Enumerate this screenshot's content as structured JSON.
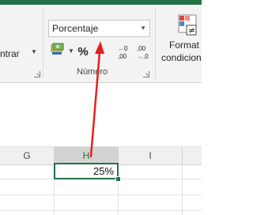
{
  "ribbon": {
    "alignment": {
      "center_label": "ntrar"
    },
    "number": {
      "format_value": "Porcentaje",
      "percent_label": "%",
      "comma_label": ",",
      "increase_decimal_top": "←0",
      "increase_decimal_bottom": ",00",
      "decrease_decimal_top": ",00",
      "decrease_decimal_bottom": "→,0",
      "group_label": "Número"
    },
    "styles": {
      "cond_format_line1": "Format",
      "cond_format_line2": "condicion"
    }
  },
  "sheet": {
    "columns": [
      "G",
      "H",
      "I"
    ],
    "selected_column": "H",
    "active_cell_value": "25%"
  },
  "annotation": {
    "arrow_color": "#e52020"
  },
  "colors": {
    "accent": "#217346"
  }
}
